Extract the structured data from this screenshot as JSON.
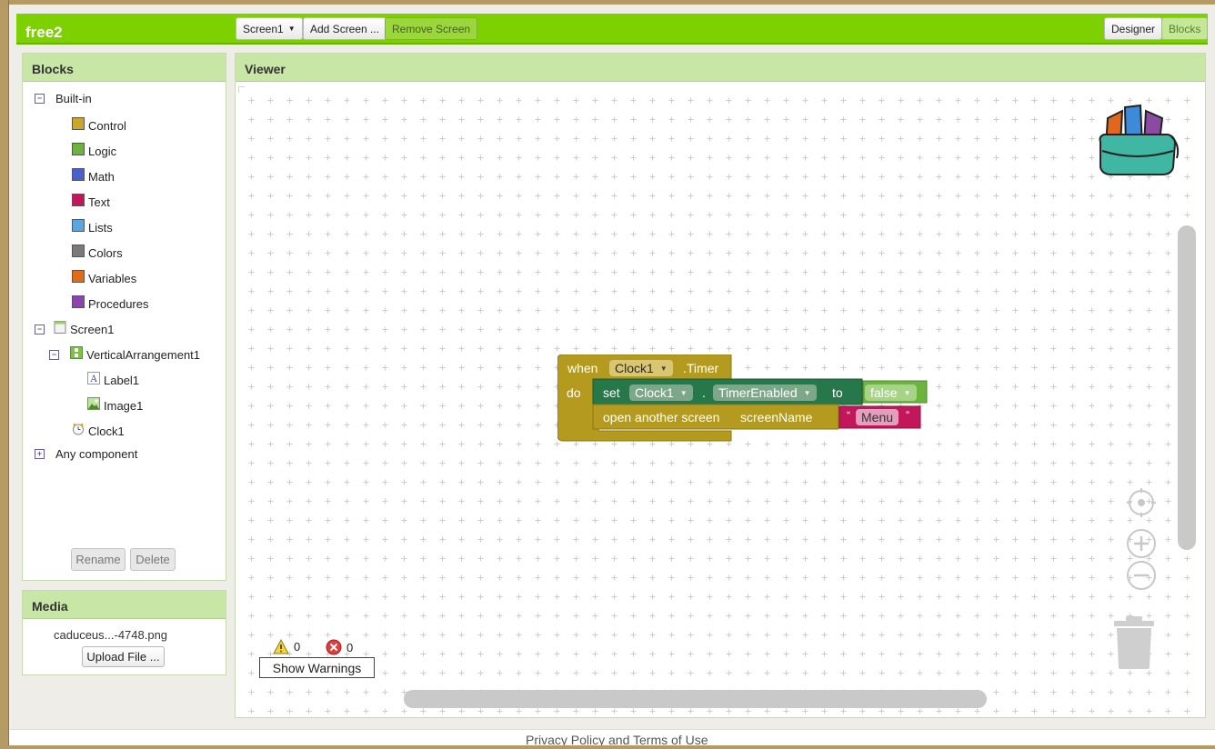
{
  "app": {
    "title": "free2"
  },
  "toolbar": {
    "screen_select": "Screen1",
    "add_screen": "Add Screen ...",
    "remove_screen": "Remove Screen",
    "designer": "Designer",
    "blocks": "Blocks"
  },
  "blocks_panel": {
    "title": "Blocks",
    "builtin": {
      "label": "Built-in",
      "items": [
        {
          "label": "Control",
          "color": "#c9a72c"
        },
        {
          "label": "Logic",
          "color": "#6db33f"
        },
        {
          "label": "Math",
          "color": "#4a5fcd"
        },
        {
          "label": "Text",
          "color": "#c2185b"
        },
        {
          "label": "Lists",
          "color": "#5ba6e0"
        },
        {
          "label": "Colors",
          "color": "#7a7a7a"
        },
        {
          "label": "Variables",
          "color": "#e06c18"
        },
        {
          "label": "Procedures",
          "color": "#8e44ad"
        }
      ]
    },
    "components": {
      "screen": "Screen1",
      "arrangement": "VerticalArrangement1",
      "label": "Label1",
      "image": "Image1",
      "clock": "Clock1",
      "any": "Any component"
    },
    "rename": "Rename",
    "delete": "Delete"
  },
  "media_panel": {
    "title": "Media",
    "file": "caduceus...-4748.png",
    "upload": "Upload File ..."
  },
  "viewer": {
    "title": "Viewer",
    "event_block": {
      "when": "when",
      "component": "Clock1",
      "event": ".Timer",
      "do": "do",
      "colors": {
        "event": "#b49a1e",
        "setter": "#26784a",
        "logic": "#6db33f",
        "text": "#c2185b"
      }
    },
    "set_block": {
      "set": "set",
      "component": "Clock1",
      "dot": ".",
      "property": "TimerEnabled",
      "to": "to",
      "value": "false"
    },
    "open_block": {
      "label": "open another screen",
      "param": "screenName",
      "quote_open": "“",
      "text": "Menu",
      "quote_close": "”"
    },
    "warnings_count": "0",
    "errors_count": "0",
    "show_warnings": "Show Warnings"
  },
  "footer": {
    "link": "Privacy Policy and Terms of Use"
  }
}
